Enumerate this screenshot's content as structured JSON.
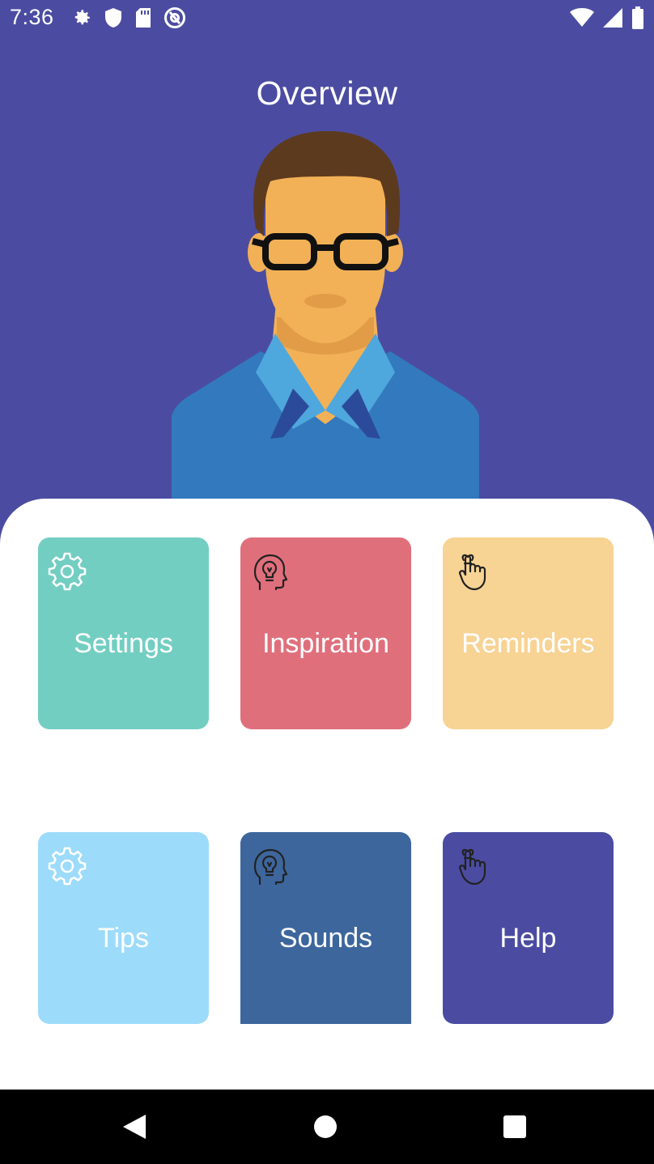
{
  "status_bar": {
    "time": "7:36",
    "left_icons": [
      "gear-icon",
      "shield-icon",
      "sd-card-icon",
      "at-sign-icon"
    ],
    "right_icons": [
      "wifi-icon",
      "signal-icon",
      "battery-icon"
    ]
  },
  "header": {
    "title": "Overview"
  },
  "colors": {
    "background": "#4B4CA1",
    "settings": "#73CEC2",
    "inspiration": "#E06F7C",
    "reminders": "#F7D394",
    "tips": "#9DDBFA",
    "sounds": "#3D669D",
    "help": "#4B4CA1"
  },
  "tiles": [
    {
      "label": "Settings",
      "icon": "gear-icon"
    },
    {
      "label": "Inspiration",
      "icon": "head-lightbulb-icon"
    },
    {
      "label": "Reminders",
      "icon": "finger-string-icon"
    },
    {
      "label": "Tips",
      "icon": "gear-icon"
    },
    {
      "label": "Sounds",
      "icon": "head-lightbulb-icon"
    },
    {
      "label": "Help",
      "icon": "finger-string-icon"
    }
  ],
  "nav_bar": {
    "buttons": [
      "back-icon",
      "home-icon",
      "recents-icon"
    ]
  }
}
